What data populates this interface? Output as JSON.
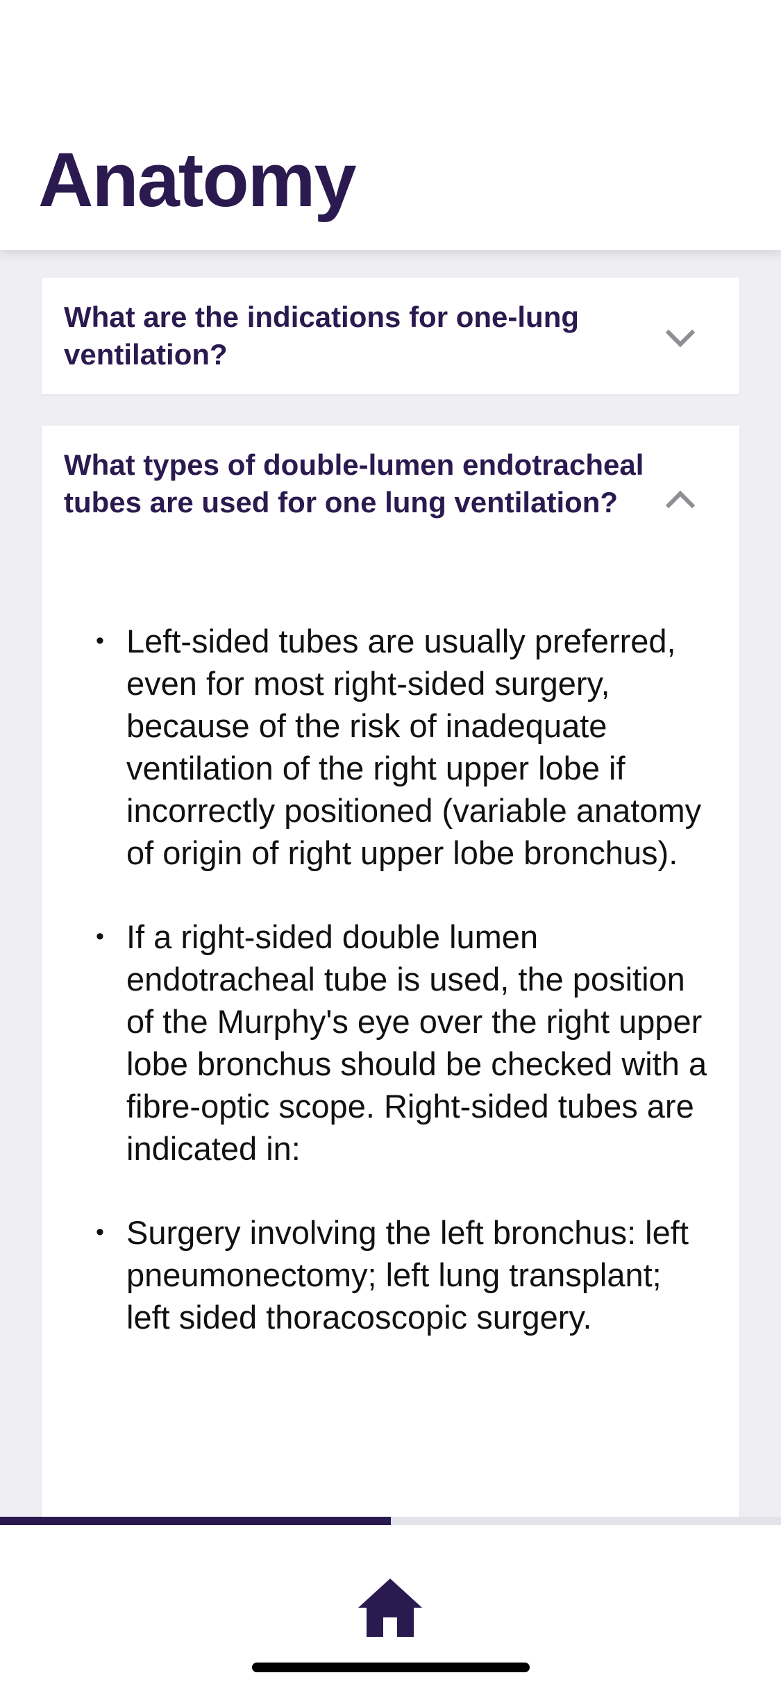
{
  "header": {
    "title": "Anatomy"
  },
  "cards": [
    {
      "question": "What are the indications for one-lung ventilation?",
      "expanded": false,
      "icon": "chevron-down-icon"
    },
    {
      "question": "What types of double-lumen endotracheal tubes are used for one lung ventilation?",
      "expanded": true,
      "icon": "chevron-up-icon",
      "answer_bullets": [
        "Left-sided tubes are usually preferred, even for most right-sided surgery, because of the risk of inadequate ventilation of the right upper lobe if incorrectly positioned (variable anatomy of origin of right upper lobe bronchus).",
        "If a right-sided double lumen endotracheal tube is used, the position of the Murphy's eye over the right upper lobe bronchus should be checked with a fibre-optic scope. Right-sided tubes are indicated in:",
        "Surgery involving the left bronchus: left pneumonectomy; left lung transplant; left sided thoracoscopic surgery."
      ]
    }
  ],
  "progress": {
    "fraction": 0.5
  },
  "bottom_nav": {
    "home_icon": "home-icon"
  },
  "colors": {
    "primary": "#2a1a4f",
    "background": "#eeeef3",
    "chevron": "#8e8e93"
  }
}
